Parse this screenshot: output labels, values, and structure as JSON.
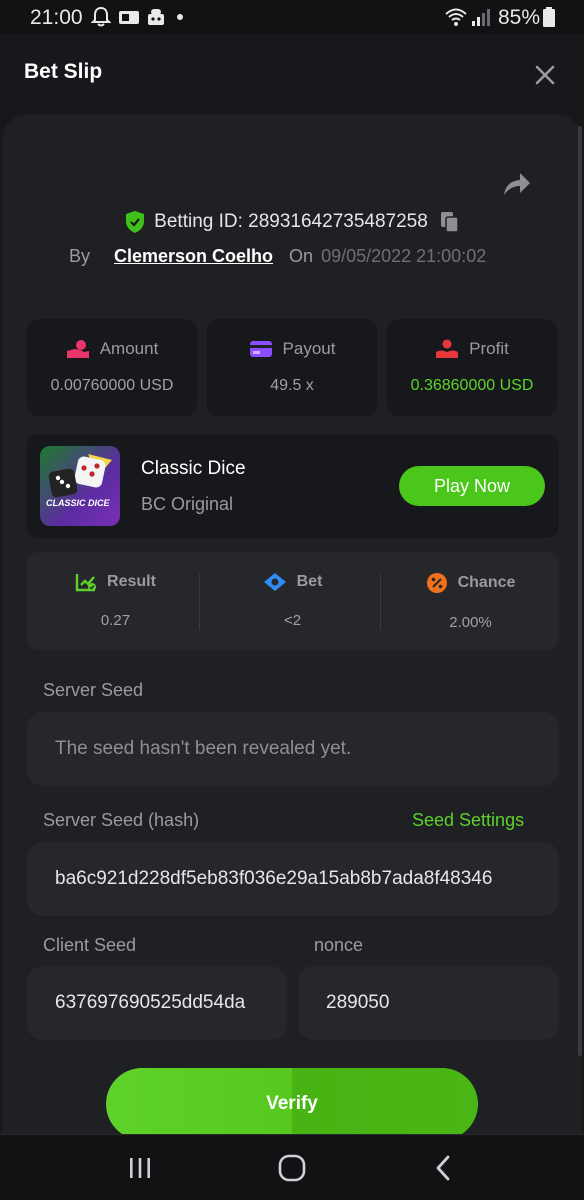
{
  "status_bar": {
    "time": "21:00",
    "battery": "85%",
    "icons": [
      "bell-icon",
      "ticket-icon",
      "android-icon",
      "dot-icon",
      "wifi-icon",
      "signal-icon",
      "battery-icon"
    ]
  },
  "header": {
    "title": "Bet Slip",
    "close_icon": "close-icon"
  },
  "bet": {
    "id_label": "Betting ID: 28931642735487258",
    "by_label": "By",
    "user": "Clemerson Coelho",
    "on_label": "On",
    "date": "09/05/2022 21:00:02"
  },
  "stats": [
    {
      "label": "Amount",
      "value": "0.00760000 USD",
      "icon": "amount-icon",
      "color": "#e8366b"
    },
    {
      "label": "Payout",
      "value": "49.5 x",
      "icon": "payout-icon",
      "color": "#8b4dff"
    },
    {
      "label": "Profit",
      "value": "0.36860000 USD",
      "icon": "profit-icon",
      "color": "#e8363a"
    }
  ],
  "game": {
    "name": "Classic Dice",
    "provider": "BC Original",
    "thumb_title": "CLASSIC DICE",
    "play_label": "Play Now"
  },
  "result_bar": [
    {
      "label": "Result",
      "value": "0.27",
      "icon": "result-icon",
      "color": "#5dd22a"
    },
    {
      "label": "Bet",
      "value": "<2",
      "icon": "bet-icon",
      "color": "#2f8df5"
    },
    {
      "label": "Chance",
      "value": "2.00%",
      "icon": "chance-icon",
      "color": "#f2721c"
    }
  ],
  "seeds": {
    "server_seed_label": "Server Seed",
    "server_seed_value": "The seed hasn't been revealed yet.",
    "server_hash_label": "Server Seed (hash)",
    "seed_settings_label": "Seed Settings",
    "server_hash_value": "ba6c921d228df5eb83f036e29a15ab8b7ada8f48346",
    "client_seed_label": "Client Seed",
    "client_seed_value": "637697690525dd54da",
    "nonce_label": "nonce",
    "nonce_value": "289050"
  },
  "verify_label": "Verify",
  "colors": {
    "accent_green": "#4bc71b",
    "background": "#17181b",
    "panel": "#1f2024"
  }
}
